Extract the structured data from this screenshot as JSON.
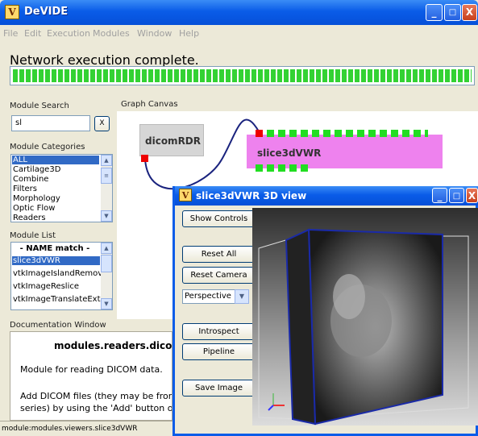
{
  "window": {
    "title": "DeVIDE",
    "app_icon_letter": "V",
    "controls": [
      "_",
      "□",
      "X"
    ]
  },
  "menu": [
    "File",
    "Edit",
    "Execution",
    "Modules",
    "Window",
    "Help"
  ],
  "status": {
    "text": "Network execution complete.",
    "progress": 1.0
  },
  "module_search": {
    "header": "Module Search",
    "value": "sl",
    "clear_label": "X"
  },
  "module_categories": {
    "header": "Module Categories",
    "items": [
      "ALL",
      "Cartilage3D",
      "Combine",
      "Filters",
      "Morphology",
      "Optic Flow",
      "Readers"
    ]
  },
  "module_list": {
    "header": "Module List",
    "items": [
      "- NAME match -",
      "slice3dVWR",
      "vtkImageIslandRemoval",
      "vtkImageReslice",
      "vtkImageTranslateExten"
    ]
  },
  "graph_canvas": {
    "header": "Graph Canvas",
    "module1": "dicomRDR",
    "module2": "slice3dVWR"
  },
  "documentation": {
    "header": "Documentation Window",
    "title": "modules.readers.dicomR",
    "line1": "Module for reading DICOM data.",
    "line2": "Add DICOM files (they may be from",
    "line3": "series) by using the 'Add' button or"
  },
  "bottom_status": "module:modules.viewers.slice3dVWR",
  "view3d": {
    "title": "slice3dVWR 3D view",
    "buttons": {
      "show_controls": "Show Controls",
      "reset_all": "Reset All",
      "reset_camera": "Reset Camera",
      "introspect": "Introspect",
      "pipeline": "Pipeline",
      "save_image": "Save Image"
    },
    "projection": "Perspective"
  },
  "colors": {
    "accent": "#0a5ce8",
    "module_pink": "#ee82ee",
    "port_green": "#22dd22",
    "port_red": "#ee0000",
    "selection": "#316ac5"
  }
}
